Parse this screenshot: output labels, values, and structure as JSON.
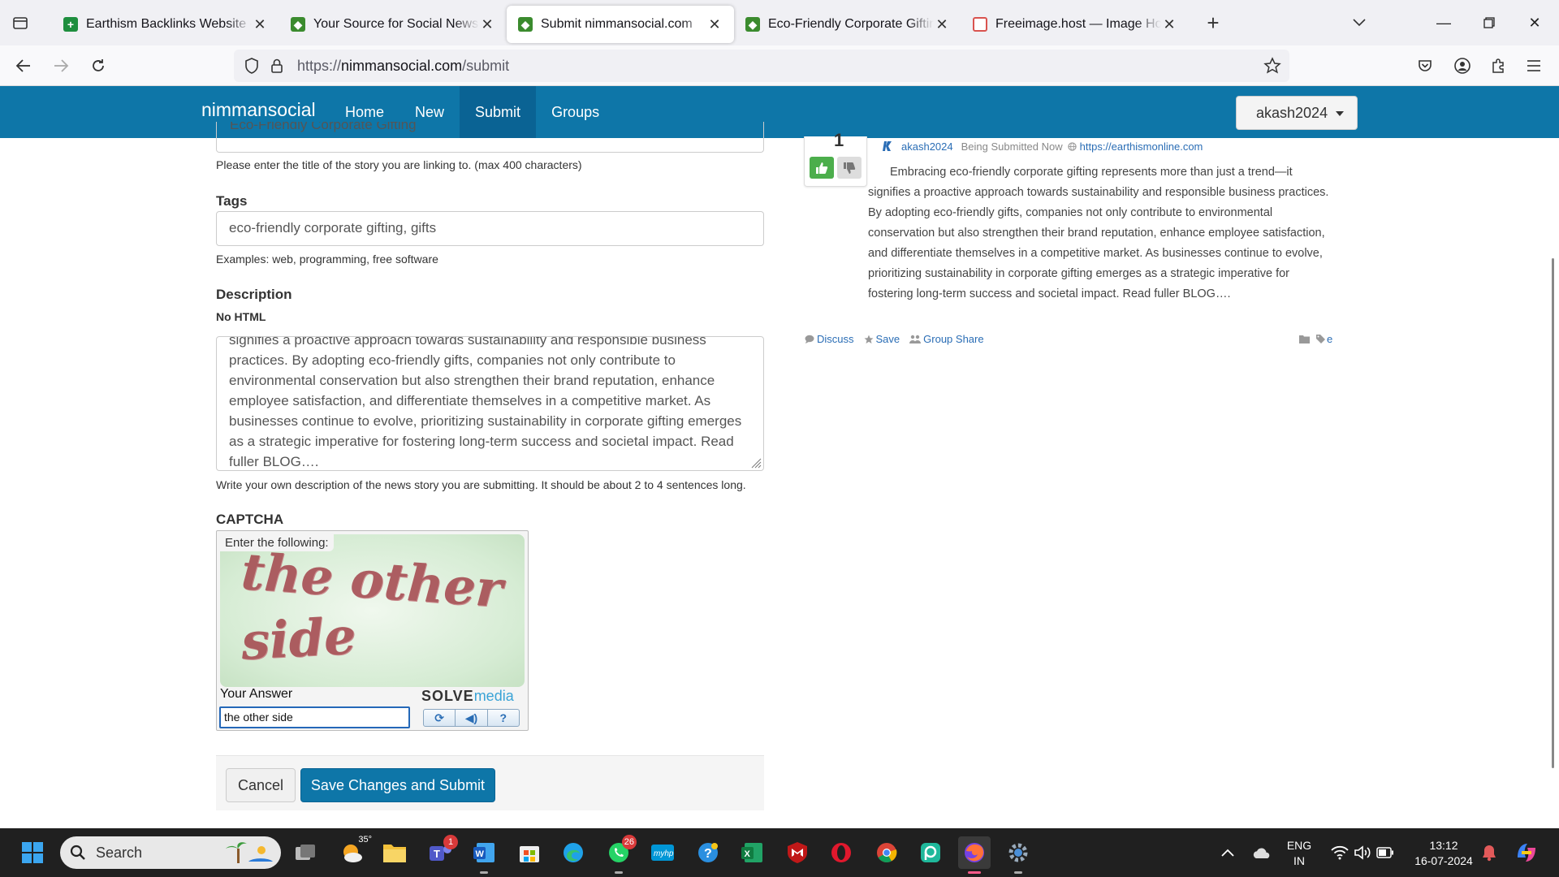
{
  "browser": {
    "tabs": [
      {
        "title": "Earthism Backlinks Website - Go",
        "favicon_color": "#1e8e3e",
        "active": false
      },
      {
        "title": "Your Source for Social News and",
        "favicon_color": "#3b8b2e",
        "active": false
      },
      {
        "title": "Submit nimmansocial.com",
        "favicon_color": "#3b8b2e",
        "active": true
      },
      {
        "title": "Eco-Friendly Corporate Gifting",
        "favicon_color": "#3b8b2e",
        "active": false
      },
      {
        "title": "Freeimage.host — Image Hostin",
        "favicon_color": "#d9534f",
        "active": false
      }
    ],
    "url_scheme": "https://",
    "url_host": "nimmansocial.com",
    "url_path": "/submit"
  },
  "site": {
    "brand": "nimmansocial",
    "nav": [
      {
        "label": "Home",
        "active": false
      },
      {
        "label": "New",
        "active": false
      },
      {
        "label": "Submit",
        "active": true
      },
      {
        "label": "Groups",
        "active": false
      }
    ],
    "user": "akash2024",
    "accent": "#0e76a8"
  },
  "form": {
    "title_value": "Eco-Friendly Corporate Gifting",
    "title_help": "Please enter the title of the story you are linking to. (max 400 characters)",
    "tags_label": "Tags",
    "tags_value": "eco-friendly corporate gifting, gifts",
    "tags_help": "Examples: web, programming, free software",
    "description_label": "Description",
    "description_note": "No HTML",
    "description_value": "signifies a proactive approach towards sustainability and responsible business practices. By adopting eco-friendly gifts, companies not only contribute to environmental conservation but also strengthen their brand reputation, enhance employee satisfaction, and differentiate themselves in a competitive market. As businesses continue to evolve, prioritizing sustainability in corporate gifting emerges as a strategic imperative for fostering long-term success and societal impact. Read fuller BLOG….",
    "description_help": "Write your own description of the news story you are submitting. It should be about 2 to 4 sentences long.",
    "captcha_label": "CAPTCHA",
    "captcha_prompt": "Enter the following:",
    "captcha_word1": "the other",
    "captcha_word2": "side",
    "captcha_answer_label": "Your Answer",
    "captcha_answer_value": "the other side",
    "captcha_brand_1": "SOLVE",
    "captcha_brand_2": "media",
    "cancel_label": "Cancel",
    "submit_label": "Save Changes and Submit"
  },
  "preview": {
    "vote_count": "1",
    "author": "akash2024",
    "when": "Being Submitted Now",
    "link": "https://earthismonline.com",
    "body": "Embracing eco-friendly corporate gifting represents more than just a trend—it signifies a proactive approach towards sustainability and responsible business practices. By adopting eco-friendly gifts, companies not only contribute to environmental conservation but also strengthen their brand reputation, enhance employee satisfaction, and differentiate themselves in a competitive market. As businesses continue to evolve, prioritizing sustainability in corporate gifting emerges as a strategic imperative for fostering long-term success and societal impact. Read fuller BLOG….",
    "actions": [
      "Discuss",
      "Save",
      "Group Share"
    ],
    "tag": "e"
  },
  "taskbar": {
    "search_placeholder": "Search",
    "weather_temp": "35°",
    "teams_badge": "1",
    "whatsapp_badge": "26",
    "language_1": "ENG",
    "language_2": "IN",
    "time": "13:12",
    "date": "16-07-2024"
  }
}
